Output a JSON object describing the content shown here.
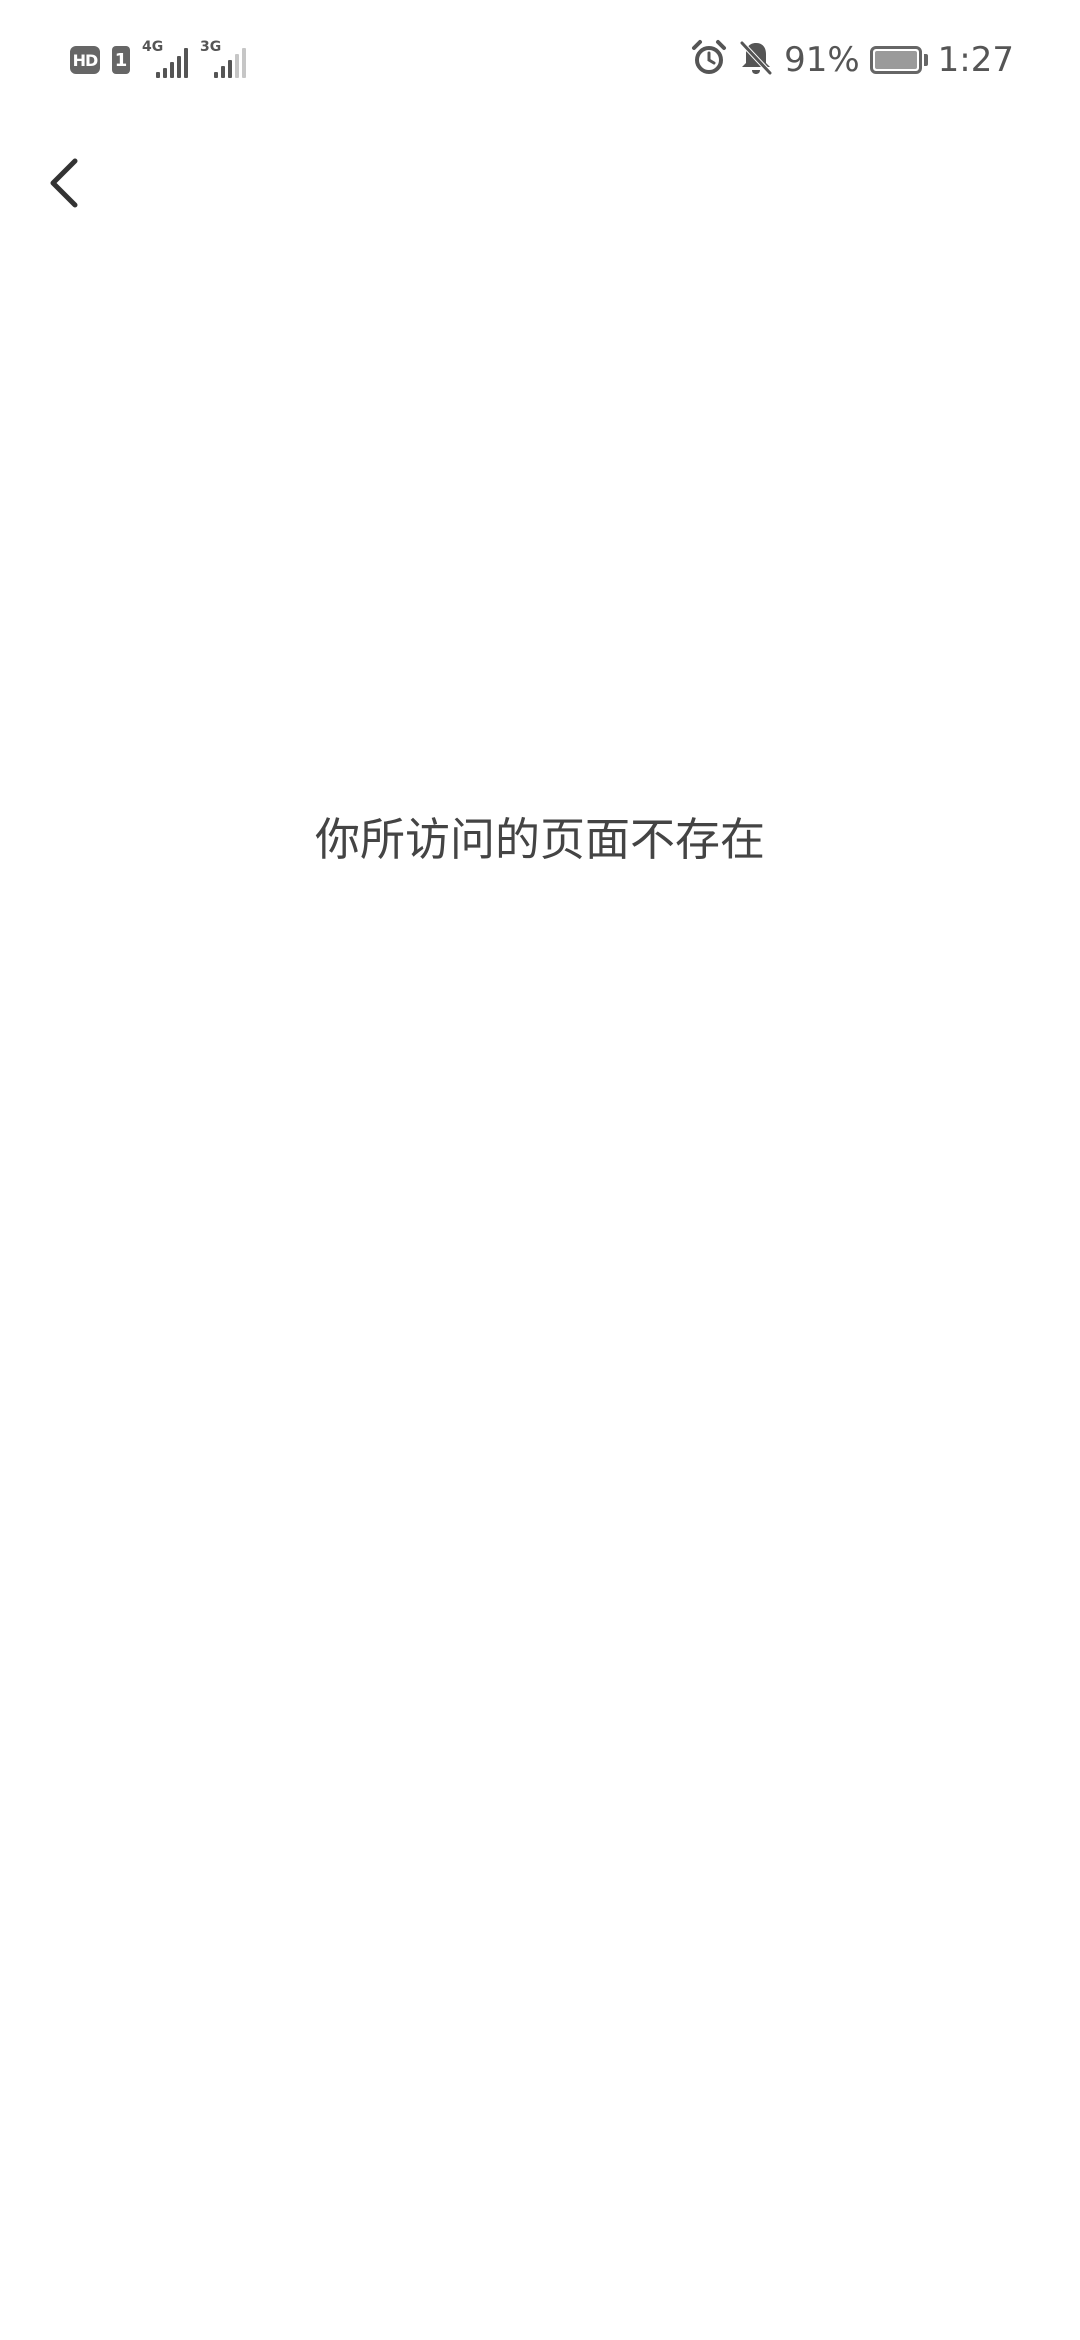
{
  "status_bar": {
    "hd_badge": "HD",
    "sim_slot": "1",
    "network_1": "4G",
    "network_2": "3G",
    "battery_percent": "91%",
    "time": "1:27",
    "icons": [
      "alarm-icon",
      "bell-muted-icon",
      "battery-charging-icon"
    ]
  },
  "nav": {
    "back_icon": "chevron-left-icon"
  },
  "main": {
    "message": "你所访问的页面不存在"
  },
  "colors": {
    "background": "#ffffff",
    "text": "#444444",
    "status_icon": "#555555"
  }
}
